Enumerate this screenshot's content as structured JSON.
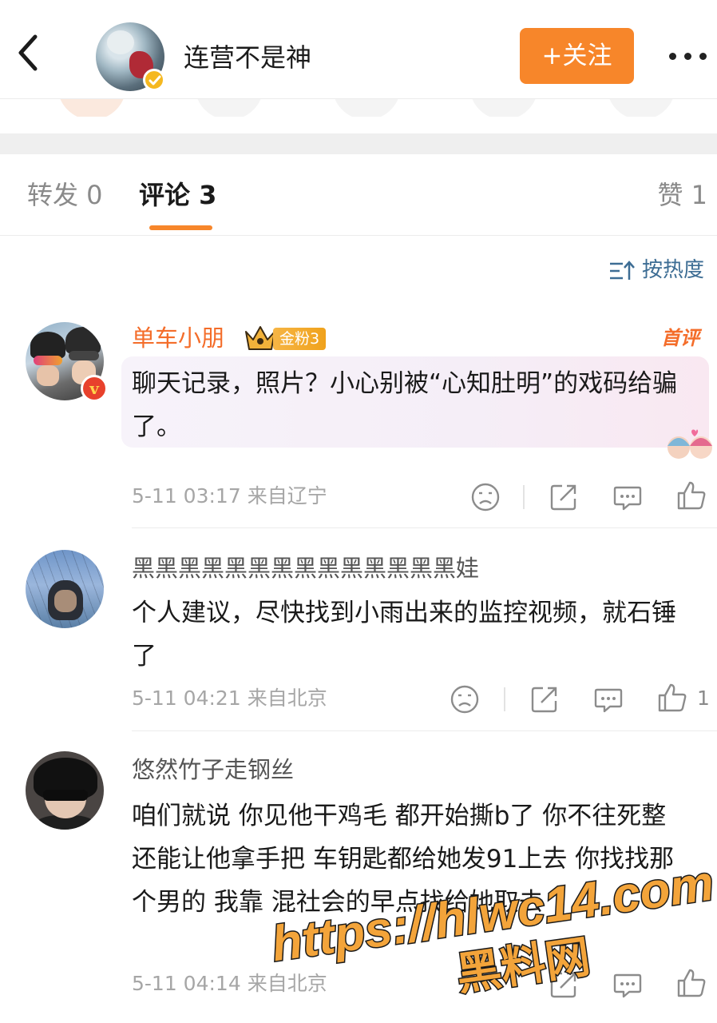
{
  "header": {
    "title": "连营不是神",
    "follow_label": "+关注"
  },
  "tabs": {
    "repost": "转发 0",
    "comments": "评论 3",
    "likes": "赞 1"
  },
  "sort": {
    "label": "按热度"
  },
  "comments": [
    {
      "username": "单车小朋",
      "fan_badge": "金粉3",
      "tag": "首评",
      "text": "聊天记录，照片？小心别被“心知肚明”的戏码给骗了。",
      "time": "5-11 03:17",
      "location": "来自辽宁",
      "likes": ""
    },
    {
      "username": "黑黑黑黑黑黑黑黑黑黑黑黑黑黑娃",
      "text": "个人建议，尽快找到小雨出来的监控视频，就石锤了",
      "time": "5-11 04:21",
      "location": "来自北京",
      "likes": "1"
    },
    {
      "username": "悠然竹子走钢丝",
      "text": "咱们就说 你见他干鸡毛 都开始撕b了 你不往死整 还能让他拿手把 车钥匙都给她发91上去 你找找那个男的 我靠 混社会的早点找给她取去",
      "time": "5-11 04:14",
      "location": "来自北京",
      "likes": ""
    }
  ],
  "watermark": {
    "line1": "https://hlwc14.com",
    "line2": "黑料网"
  },
  "colors": {
    "accent": "#f7862a",
    "username_highlight": "#f46d2a",
    "meta_gray": "#a6a6a6",
    "sort_blue": "#3d6d94"
  },
  "icons": [
    "back-icon",
    "verified-icon",
    "more-icon",
    "sort-icon",
    "dislike-icon",
    "share-icon",
    "reply-icon",
    "like-icon",
    "crown-icon"
  ]
}
